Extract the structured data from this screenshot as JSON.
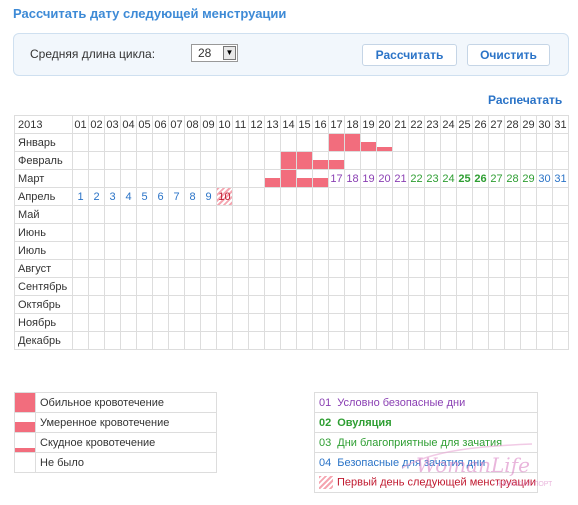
{
  "title": "Рассчитать дату следующей менструации",
  "form": {
    "cycle_label": "Средняя длина цикла:",
    "cycle_value": "28",
    "calculate_label": "Рассчитать",
    "clear_label": "Очистить"
  },
  "print_label": "Распечатать",
  "calendar": {
    "year": "2013",
    "days": [
      "01",
      "02",
      "03",
      "04",
      "05",
      "06",
      "07",
      "08",
      "09",
      "10",
      "11",
      "12",
      "13",
      "14",
      "15",
      "16",
      "17",
      "18",
      "19",
      "20",
      "21",
      "22",
      "23",
      "24",
      "25",
      "26",
      "27",
      "28",
      "29",
      "30",
      "31"
    ],
    "months": [
      "Январь",
      "Февраль",
      "Март",
      "Апрель",
      "Май",
      "Июнь",
      "Июль",
      "Август",
      "Сентябрь",
      "Октябрь",
      "Ноябрь",
      "Декабрь"
    ],
    "march_labels": [
      {
        "day": 17,
        "text": "17",
        "type": "safe"
      },
      {
        "day": 18,
        "text": "18",
        "type": "safe"
      },
      {
        "day": 19,
        "text": "19",
        "type": "safe"
      },
      {
        "day": 20,
        "text": "20",
        "type": "safe"
      },
      {
        "day": 21,
        "text": "21",
        "type": "safe"
      },
      {
        "day": 22,
        "text": "22",
        "type": "favorable"
      },
      {
        "day": 23,
        "text": "23",
        "type": "favorable"
      },
      {
        "day": 24,
        "text": "24",
        "type": "favorable"
      },
      {
        "day": 25,
        "text": "25",
        "type": "ovulation"
      },
      {
        "day": 26,
        "text": "26",
        "type": "ovulation"
      },
      {
        "day": 27,
        "text": "27",
        "type": "favorable"
      },
      {
        "day": 28,
        "text": "28",
        "type": "favorable"
      },
      {
        "day": 29,
        "text": "29",
        "type": "favorable"
      },
      {
        "day": 30,
        "text": "30",
        "type": "unsafe"
      },
      {
        "day": 31,
        "text": "31",
        "type": "unsafe"
      }
    ],
    "april_labels": [
      {
        "day": 1,
        "text": "1",
        "type": "unsafe"
      },
      {
        "day": 2,
        "text": "2",
        "type": "unsafe"
      },
      {
        "day": 3,
        "text": "3",
        "type": "unsafe"
      },
      {
        "day": 4,
        "text": "4",
        "type": "unsafe"
      },
      {
        "day": 5,
        "text": "5",
        "type": "unsafe"
      },
      {
        "day": 6,
        "text": "6",
        "type": "unsafe"
      },
      {
        "day": 7,
        "text": "7",
        "type": "unsafe"
      },
      {
        "day": 8,
        "text": "8",
        "type": "unsafe"
      },
      {
        "day": 9,
        "text": "9",
        "type": "unsafe"
      },
      {
        "day": 10,
        "text": "10",
        "type": "first"
      }
    ],
    "bleeding": [
      {
        "month": 0,
        "day": 17,
        "level": "heavy"
      },
      {
        "month": 0,
        "day": 18,
        "level": "heavy"
      },
      {
        "month": 0,
        "day": 19,
        "level": "moderate"
      },
      {
        "month": 0,
        "day": 20,
        "level": "light"
      },
      {
        "month": 1,
        "day": 14,
        "level": "heavy"
      },
      {
        "month": 1,
        "day": 15,
        "level": "heavy"
      },
      {
        "month": 1,
        "day": 16,
        "level": "moderate"
      },
      {
        "month": 1,
        "day": 17,
        "level": "moderate"
      },
      {
        "month": 2,
        "day": 13,
        "level": "moderate"
      },
      {
        "month": 2,
        "day": 14,
        "level": "heavy"
      },
      {
        "month": 2,
        "day": 15,
        "level": "moderate"
      },
      {
        "month": 2,
        "day": 16,
        "level": "moderate"
      }
    ]
  },
  "legend_bleeding": [
    {
      "level": "heavy",
      "label": "Обильное кровотечение"
    },
    {
      "level": "moderate",
      "label": "Умеренное кровотечение"
    },
    {
      "level": "light",
      "label": "Скудное кровотечение"
    },
    {
      "level": "none",
      "label": "Не было"
    }
  ],
  "legend_days": [
    {
      "num": "01",
      "label": "Условно безопасные дни",
      "type": "safe"
    },
    {
      "num": "02",
      "label": "Овуляция",
      "type": "ovulation"
    },
    {
      "num": "03",
      "label": "Дни благоприятные для зачатия",
      "type": "favorable"
    },
    {
      "num": "04",
      "label": "Безопасные для зачатия дни",
      "type": "unsafe"
    },
    {
      "num": "",
      "label": "Первый день следующей менструации",
      "type": "first"
    }
  ],
  "watermark": {
    "logo": "WomanLife",
    "subtitle": "ЖЕНСКИЙ ПОРТАЛ"
  },
  "colors": {
    "accent_blue": "#2a73c7",
    "bleeding": "#f26d7d",
    "safe": "#8a3fb3",
    "favorable": "#2e9e32",
    "unsafe": "#2a73c7",
    "first_day": "#c0192f"
  }
}
